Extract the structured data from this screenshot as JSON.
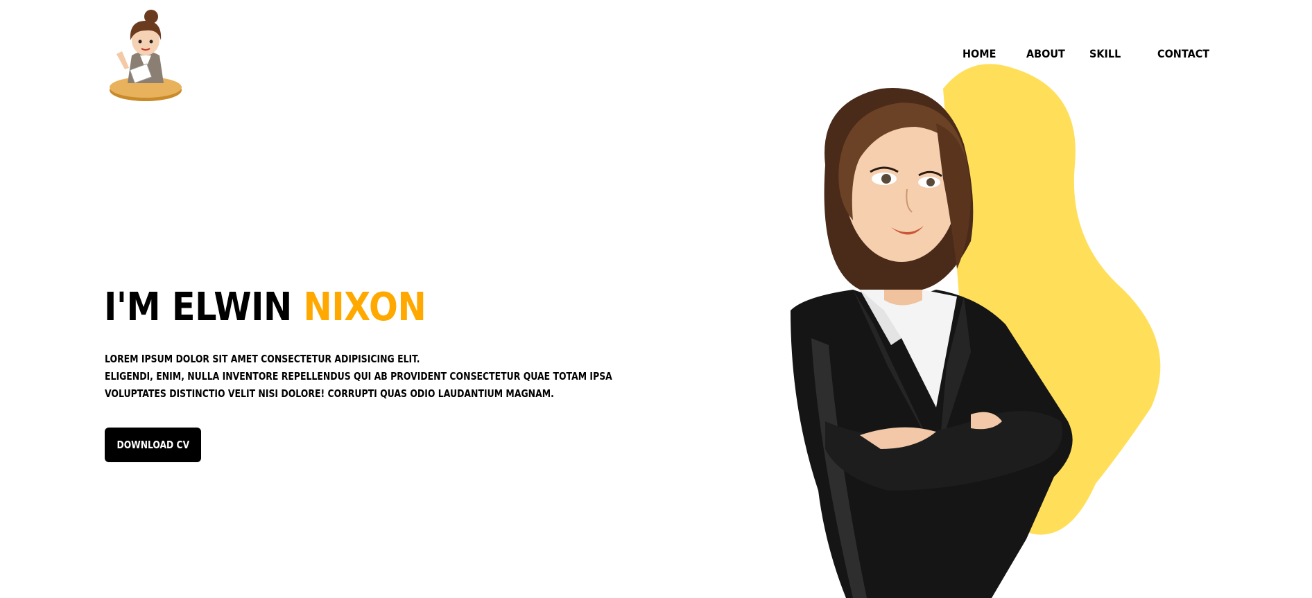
{
  "nav": {
    "items": [
      "HOME",
      "ABOUT",
      "SKILL",
      "CONTACT"
    ]
  },
  "hero": {
    "title_prefix": "I'M ELWIN",
    "title_accent": "NIXON",
    "lines": [
      "LOREM IPSUM DOLOR SIT AMET CONSECTETUR ADIPISICING ELIT.",
      "ELIGENDI, ENIM, NULLA INVENTORE REPELLENDUS QUI AB PROVIDENT CONSECTETUR QUAE TOTAM IPSA",
      "VOLUPTATES DISTINCTIO VELIT NISI DOLORE! CORRUPTI QUAS ODIO LAUDANTIUM MAGNAM."
    ],
    "cta_label": "DOWNLOAD CV"
  },
  "colors": {
    "accent": "#ffa800",
    "blob": "#ffdf5a",
    "button": "#000000"
  },
  "icons": {
    "logo": "woman-at-desk-logo-icon",
    "illustration": "businesswoman-illustration"
  }
}
